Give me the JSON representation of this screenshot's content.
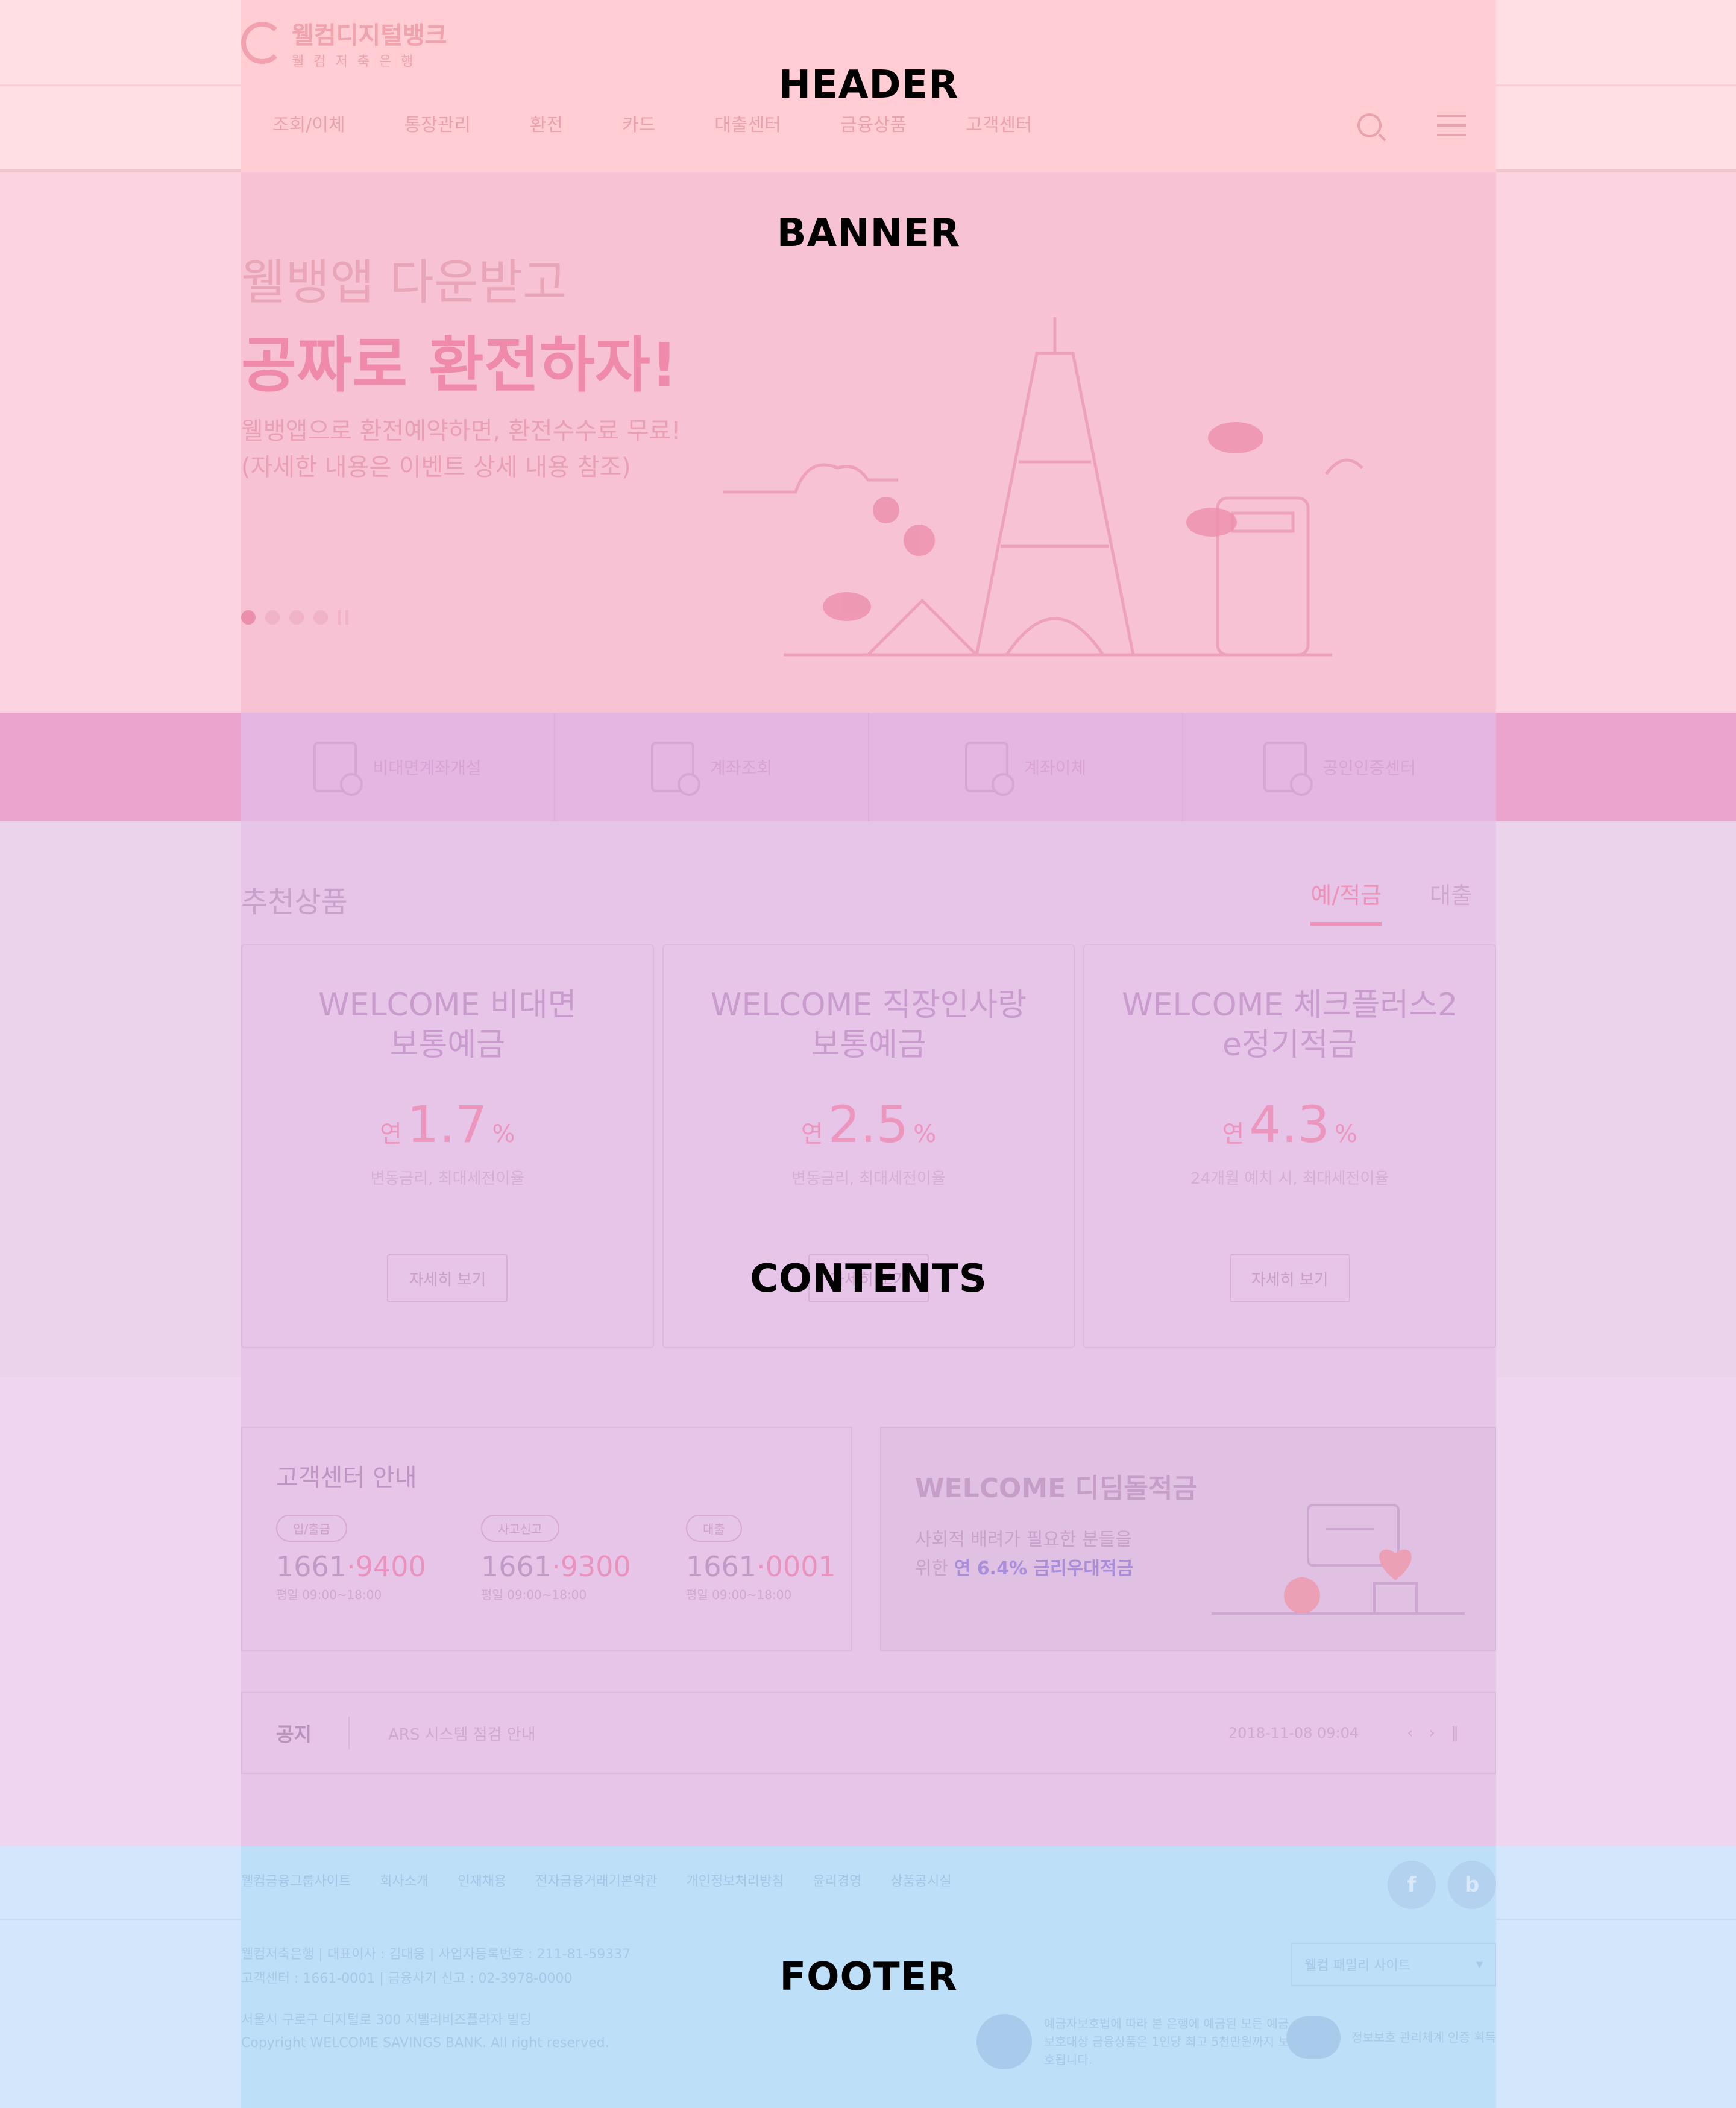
{
  "labels": {
    "header": "HEADER",
    "banner": "BANNER",
    "contents": "CONTENTS",
    "footer": "FOOTER"
  },
  "header": {
    "logo_name": "웰컴디지털뱅크",
    "logo_sub": "웰컴저축은행",
    "gnb": [
      "조회/이체",
      "통장관리",
      "환전",
      "카드",
      "대출센터",
      "금융상품",
      "고객센터"
    ]
  },
  "banner": {
    "line1": "웰뱅앱 다운받고",
    "line2": "공짜로 환전하자!",
    "desc1": "웰뱅앱으로 환전예약하면, 환전수수료 무료!",
    "desc2": "(자세한 내용은 이벤트 상세 내용 참조)"
  },
  "quick": [
    {
      "label": "비대면계좌개설",
      "icon": "phone-account-icon"
    },
    {
      "label": "계좌조회",
      "icon": "account-search-icon"
    },
    {
      "label": "계좌이체",
      "icon": "transfer-icon"
    },
    {
      "label": "공인인증센터",
      "icon": "certificate-icon"
    }
  ],
  "products": {
    "title": "추천상품",
    "tabs": [
      "예/적금",
      "대출"
    ],
    "cards": [
      {
        "name1": "WELCOME 비대면",
        "name2": "보통예금",
        "rate_pre": "연",
        "rate": "1.7",
        "rate_unit": "%",
        "note": "변동금리, 최대세전이율",
        "button": "자세히 보기"
      },
      {
        "name1": "WELCOME 직장인사랑",
        "name2": "보통예금",
        "rate_pre": "연",
        "rate": "2.5",
        "rate_unit": "%",
        "note": "변동금리, 최대세전이율",
        "button": "자세히 보기"
      },
      {
        "name1": "WELCOME 체크플러스2",
        "name2": "e정기적금",
        "rate_pre": "연",
        "rate": "4.3",
        "rate_unit": "%",
        "note": "24개월 예치 시, 최대세전이율",
        "button": "자세히 보기"
      }
    ]
  },
  "customer_center": {
    "title": "고객센터 안내",
    "items": [
      {
        "tag": "입/출금",
        "num_a": "1661",
        "num_b": "·9400",
        "hours": "평일 09:00~18:00"
      },
      {
        "tag": "사고신고",
        "num_a": "1661",
        "num_b": "·9300",
        "hours": "평일 09:00~18:00"
      },
      {
        "tag": "대출",
        "num_a": "1661",
        "num_b": "·0001",
        "hours": "평일 09:00~18:00"
      }
    ]
  },
  "promo": {
    "title": "WELCOME 디딤돌적금",
    "desc1": "사회적 배려가 필요한 분들을",
    "desc2_pre": "위한 ",
    "desc2_hl": "연 6.4% 금리우대적금"
  },
  "notice": {
    "label": "공지",
    "text": "ARS 시스템 점검 안내",
    "date": "2018-11-08 09:04"
  },
  "footer": {
    "links": [
      "웰컴금융그룹사이트",
      "회사소개",
      "인재채용",
      "전자금융거래기본약관",
      "개인정보처리방침",
      "윤리경영",
      "상품공시실"
    ],
    "info1": "웰컴저축은행  |  대표이사 : 김대웅  |  사업자등록번호 : 211-81-59337",
    "info2": "고객센터 : 1661-0001  |  금융사기 신고 : 02-3978-0000",
    "copy1": "서울시 구로구 디지털로 300 지밸리비즈플라자 빌딩",
    "copy2": "Copyright WELCOME SAVINGS BANK. All right reserved.",
    "family_select": "웰컴 패밀리 사이트",
    "cert_text": "예금자보호법에 따라 본 은행에 예금된 모든 예금보호대상 금융상품은 1인당 최고 5천만원까지 보호됩니다.",
    "cert2_text": "정보보호 관리체계 인증 획득"
  }
}
